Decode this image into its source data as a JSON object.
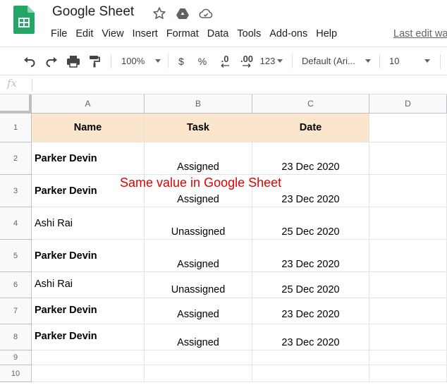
{
  "app": {
    "title": "Google Sheet",
    "menu": [
      "File",
      "Edit",
      "View",
      "Insert",
      "Format",
      "Data",
      "Tools",
      "Add-ons",
      "Help"
    ],
    "last_edit": "Last edit wa"
  },
  "toolbar": {
    "zoom": "100%",
    "currency": "$",
    "percent": "%",
    "decrease_decimal": ".0",
    "increase_decimal": ".00",
    "more_formats": "123",
    "font": "Default (Ari...",
    "font_size": "10"
  },
  "formula_bar": {
    "fx": "fx"
  },
  "grid": {
    "columns": [
      "A",
      "B",
      "C",
      "D"
    ],
    "rows": [
      "1",
      "2",
      "3",
      "4",
      "5",
      "6",
      "7",
      "8",
      "9",
      "10"
    ],
    "header": {
      "name": "Name",
      "task": "Task",
      "date": "Date"
    },
    "data": [
      {
        "name": "Parker Devin",
        "task": "Assigned",
        "date": "23 Dec 2020"
      },
      {
        "name": "Parker Devin",
        "task": "Assigned",
        "date": "23 Dec 2020"
      },
      {
        "name": "Ashi Rai",
        "task": "Unassigned",
        "date": "25 Dec 2020"
      },
      {
        "name": "Parker Devin",
        "task": "Assigned",
        "date": "23 Dec 2020"
      },
      {
        "name": "Ashi Rai",
        "task": "Unassigned",
        "date": "25 Dec 2020"
      },
      {
        "name": "Parker Devin",
        "task": "Assigned",
        "date": "23 Dec 2020"
      },
      {
        "name": "Parker Devin",
        "task": "Assigned",
        "date": "23 Dec 2020"
      }
    ]
  },
  "annotation": "Same value in Google Sheet",
  "colors": {
    "header_fill": "#fce5cd",
    "annotation": "#e60000",
    "logo_green": "#23a566"
  }
}
